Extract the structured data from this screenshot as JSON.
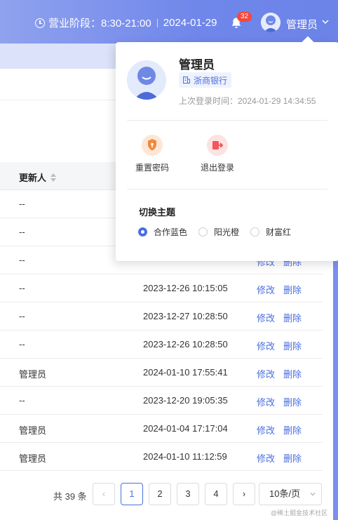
{
  "header": {
    "business_hours_label": "营业阶段：8:30-21:00",
    "date": "2024-01-29",
    "notification_count": "32",
    "user_name": "管理员"
  },
  "table": {
    "column_updater": "更新人",
    "rows": [
      {
        "updater": "--",
        "time": "",
        "edit": "",
        "delete": ""
      },
      {
        "updater": "--",
        "time": "",
        "edit": "",
        "delete": ""
      },
      {
        "updater": "--",
        "time": "",
        "edit": "修改",
        "delete": "删除"
      },
      {
        "updater": "--",
        "time": "2023-12-26 10:15:05",
        "edit": "修改",
        "delete": "删除"
      },
      {
        "updater": "--",
        "time": "2023-12-27 10:28:50",
        "edit": "修改",
        "delete": "删除"
      },
      {
        "updater": "--",
        "time": "2023-12-26 10:28:50",
        "edit": "修改",
        "delete": "删除"
      },
      {
        "updater": "管理员",
        "time": "2024-01-10 17:55:41",
        "edit": "修改",
        "delete": "删除"
      },
      {
        "updater": "--",
        "time": "2023-12-20 19:05:35",
        "edit": "修改",
        "delete": "删除"
      },
      {
        "updater": "管理员",
        "time": "2024-01-04 17:17:04",
        "edit": "修改",
        "delete": "删除"
      },
      {
        "updater": "管理员",
        "time": "2024-01-10 11:12:59",
        "edit": "修改",
        "delete": "删除"
      }
    ]
  },
  "pagination": {
    "total": "共 39 条",
    "prev": "‹",
    "pages": [
      "1",
      "2",
      "3",
      "4"
    ],
    "next": "›",
    "page_size": "10条/页"
  },
  "dropdown": {
    "name": "管理员",
    "org": "浙商银行",
    "last_login": "上次登录时间：2024-01-29 14:34:55",
    "reset_password": "重置密码",
    "logout": "退出登录",
    "theme_title": "切换主题",
    "themes": [
      "合作蓝色",
      "阳光橙",
      "财富红"
    ],
    "selected_theme": "合作蓝色"
  },
  "watermark": "@稀土掘金技术社区",
  "colors": {
    "accent": "#4a6fe0",
    "header": "#7389ea",
    "badge": "#f5483b"
  }
}
